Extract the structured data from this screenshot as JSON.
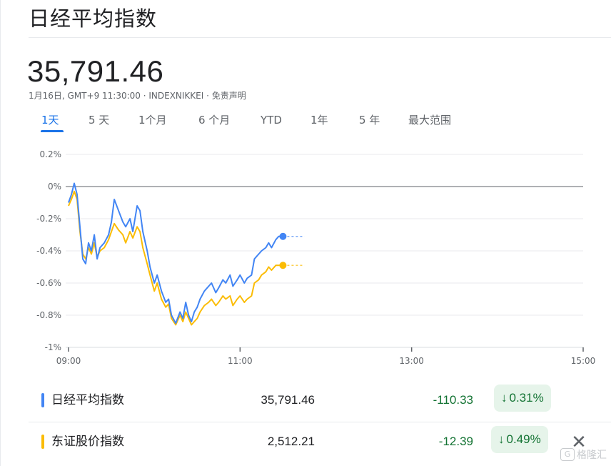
{
  "header": {
    "title": "日经平均指数",
    "price": "35,791.46",
    "subline": "1月16日, GMT+9 11:30:00 · INDEXNIKKEI · 免责声明"
  },
  "tabs": [
    "1天",
    "5 天",
    "1个月",
    "6 个月",
    "YTD",
    "1年",
    "5 年",
    "最大范围"
  ],
  "active_tab": "1天",
  "colors": {
    "accent": "#1a73e8",
    "series_nikkei": "#4285f4",
    "series_topix": "#fbbc04",
    "up_green": "#137333",
    "chip_bg": "#e6f4ea"
  },
  "chart_data": {
    "type": "line",
    "ylim": [
      -1.0,
      0.2
    ],
    "yticks": [
      "0.2%",
      "0%",
      "-0.2%",
      "-0.4%",
      "-0.6%",
      "-0.8%",
      "-1%"
    ],
    "xticks": [
      "09:00",
      "11:00",
      "13:00",
      "15:00"
    ],
    "x_unit": "time",
    "baseline": 0,
    "series": [
      {
        "name": "日经平均指数",
        "color": "#4285f4",
        "points": [
          [
            "09:00",
            -0.1
          ],
          [
            "09:02",
            -0.05
          ],
          [
            "09:04",
            0.02
          ],
          [
            "09:06",
            -0.05
          ],
          [
            "09:08",
            -0.25
          ],
          [
            "09:10",
            -0.45
          ],
          [
            "09:12",
            -0.48
          ],
          [
            "09:14",
            -0.35
          ],
          [
            "09:16",
            -0.4
          ],
          [
            "09:18",
            -0.3
          ],
          [
            "09:20",
            -0.45
          ],
          [
            "09:22",
            -0.38
          ],
          [
            "09:25",
            -0.35
          ],
          [
            "09:28",
            -0.3
          ],
          [
            "09:30",
            -0.22
          ],
          [
            "09:32",
            -0.08
          ],
          [
            "09:35",
            -0.15
          ],
          [
            "09:38",
            -0.22
          ],
          [
            "09:40",
            -0.25
          ],
          [
            "09:43",
            -0.2
          ],
          [
            "09:45",
            -0.28
          ],
          [
            "09:48",
            -0.12
          ],
          [
            "09:50",
            -0.15
          ],
          [
            "09:52",
            -0.28
          ],
          [
            "09:55",
            -0.4
          ],
          [
            "09:57",
            -0.5
          ],
          [
            "10:00",
            -0.6
          ],
          [
            "10:02",
            -0.55
          ],
          [
            "10:05",
            -0.65
          ],
          [
            "10:08",
            -0.72
          ],
          [
            "10:10",
            -0.7
          ],
          [
            "10:12",
            -0.8
          ],
          [
            "10:15",
            -0.85
          ],
          [
            "10:18",
            -0.78
          ],
          [
            "10:20",
            -0.82
          ],
          [
            "10:22",
            -0.72
          ],
          [
            "10:24",
            -0.8
          ],
          [
            "10:26",
            -0.84
          ],
          [
            "10:28",
            -0.78
          ],
          [
            "10:30",
            -0.75
          ],
          [
            "10:32",
            -0.7
          ],
          [
            "10:35",
            -0.65
          ],
          [
            "10:38",
            -0.62
          ],
          [
            "10:40",
            -0.6
          ],
          [
            "10:43",
            -0.66
          ],
          [
            "10:45",
            -0.63
          ],
          [
            "10:48",
            -0.58
          ],
          [
            "10:50",
            -0.6
          ],
          [
            "10:53",
            -0.55
          ],
          [
            "10:55",
            -0.62
          ],
          [
            "10:58",
            -0.58
          ],
          [
            "11:00",
            -0.55
          ],
          [
            "11:03",
            -0.6
          ],
          [
            "11:05",
            -0.57
          ],
          [
            "11:08",
            -0.55
          ],
          [
            "11:10",
            -0.45
          ],
          [
            "11:13",
            -0.42
          ],
          [
            "11:15",
            -0.4
          ],
          [
            "11:18",
            -0.38
          ],
          [
            "11:20",
            -0.35
          ],
          [
            "11:22",
            -0.38
          ],
          [
            "11:25",
            -0.33
          ],
          [
            "11:27",
            -0.31
          ],
          [
            "11:30",
            -0.31
          ]
        ]
      },
      {
        "name": "东证股价指数",
        "color": "#fbbc04",
        "points": [
          [
            "09:00",
            -0.12
          ],
          [
            "09:02",
            -0.08
          ],
          [
            "09:04",
            -0.03
          ],
          [
            "09:06",
            -0.08
          ],
          [
            "09:08",
            -0.28
          ],
          [
            "09:10",
            -0.42
          ],
          [
            "09:12",
            -0.45
          ],
          [
            "09:14",
            -0.38
          ],
          [
            "09:16",
            -0.42
          ],
          [
            "09:18",
            -0.35
          ],
          [
            "09:20",
            -0.44
          ],
          [
            "09:22",
            -0.4
          ],
          [
            "09:25",
            -0.38
          ],
          [
            "09:28",
            -0.33
          ],
          [
            "09:30",
            -0.28
          ],
          [
            "09:32",
            -0.23
          ],
          [
            "09:35",
            -0.27
          ],
          [
            "09:38",
            -0.3
          ],
          [
            "09:40",
            -0.35
          ],
          [
            "09:43",
            -0.28
          ],
          [
            "09:45",
            -0.32
          ],
          [
            "09:48",
            -0.25
          ],
          [
            "09:50",
            -0.28
          ],
          [
            "09:52",
            -0.38
          ],
          [
            "09:55",
            -0.48
          ],
          [
            "09:57",
            -0.55
          ],
          [
            "10:00",
            -0.65
          ],
          [
            "10:02",
            -0.6
          ],
          [
            "10:05",
            -0.7
          ],
          [
            "10:08",
            -0.75
          ],
          [
            "10:10",
            -0.73
          ],
          [
            "10:12",
            -0.82
          ],
          [
            "10:15",
            -0.86
          ],
          [
            "10:18",
            -0.8
          ],
          [
            "10:20",
            -0.84
          ],
          [
            "10:22",
            -0.78
          ],
          [
            "10:24",
            -0.82
          ],
          [
            "10:26",
            -0.86
          ],
          [
            "10:28",
            -0.84
          ],
          [
            "10:30",
            -0.82
          ],
          [
            "10:32",
            -0.78
          ],
          [
            "10:35",
            -0.74
          ],
          [
            "10:38",
            -0.72
          ],
          [
            "10:40",
            -0.7
          ],
          [
            "10:43",
            -0.74
          ],
          [
            "10:45",
            -0.72
          ],
          [
            "10:48",
            -0.68
          ],
          [
            "10:50",
            -0.7
          ],
          [
            "10:53",
            -0.68
          ],
          [
            "10:55",
            -0.74
          ],
          [
            "10:58",
            -0.7
          ],
          [
            "11:00",
            -0.68
          ],
          [
            "11:03",
            -0.72
          ],
          [
            "11:05",
            -0.7
          ],
          [
            "11:08",
            -0.68
          ],
          [
            "11:10",
            -0.6
          ],
          [
            "11:13",
            -0.58
          ],
          [
            "11:15",
            -0.55
          ],
          [
            "11:18",
            -0.53
          ],
          [
            "11:20",
            -0.5
          ],
          [
            "11:22",
            -0.52
          ],
          [
            "11:25",
            -0.49
          ],
          [
            "11:27",
            -0.49
          ],
          [
            "11:30",
            -0.49
          ]
        ]
      }
    ],
    "projection_end": "11:45"
  },
  "rows": [
    {
      "name": "日经平均指数",
      "color": "#4285f4",
      "value": "35,791.46",
      "change": "-110.33",
      "pct": "0.31%",
      "arrow": "↓"
    },
    {
      "name": "东证股价指数",
      "color": "#fbbc04",
      "value": "2,512.21",
      "change": "-12.39",
      "pct": "0.49%",
      "arrow": "↓"
    }
  ],
  "close_icon": "✕",
  "watermark": {
    "icon": "G",
    "text": "格隆汇"
  }
}
